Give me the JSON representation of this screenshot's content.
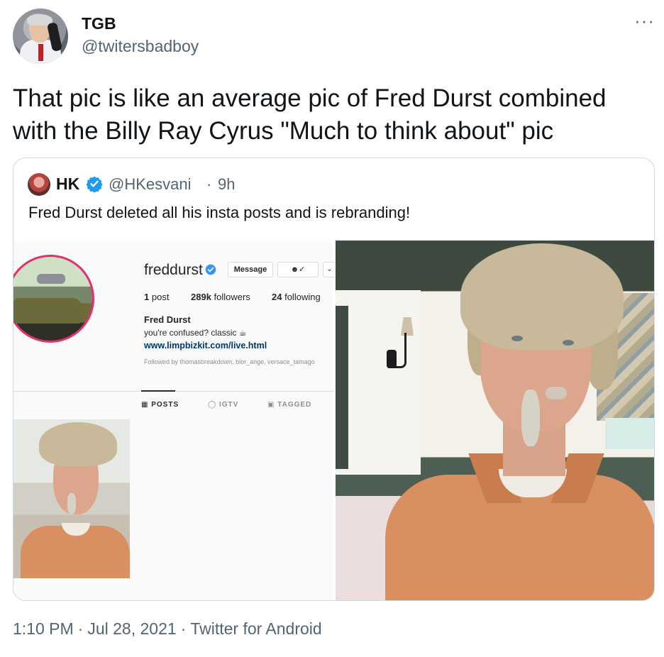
{
  "tweet": {
    "author_name": "TGB",
    "author_handle": "@twitersbadboy",
    "more_icon": "more-horizontal-icon",
    "text": "That pic is like an average pic of Fred Durst combined with the Billy Ray Cyrus \"Much to think about\" pic",
    "time": "1:10 PM",
    "date": "Jul 28, 2021",
    "source": "Twitter for Android",
    "separator": "·"
  },
  "quoted_tweet": {
    "author_name": "HK",
    "author_handle": "@HKesvani",
    "separator": "·",
    "age": "9h",
    "text": "Fred Durst deleted all his insta posts and is rebranding!",
    "verified_icon": "verified-badge-icon",
    "colors": {
      "verified": "#1d9bf0"
    }
  },
  "instagram": {
    "username": "freddurst",
    "message_button": "Message",
    "follow_icon": "person-check-icon",
    "dropdown_icon": "chevron-down-icon",
    "posts_count": "1",
    "posts_label": "post",
    "followers_count": "289k",
    "followers_label": "followers",
    "following_count": "24",
    "following_label": "following",
    "full_name": "Fred Durst",
    "bio": "you're confused? classic ☕",
    "link": "www.limpbizkit.com/live.html",
    "followed_by": "Followed by thomasbreakdown, blor_ange, versace_tamago",
    "tabs": [
      {
        "label": "POSTS",
        "icon": "grid-icon"
      },
      {
        "label": "IGTV",
        "icon": "igtv-icon"
      },
      {
        "label": "TAGGED",
        "icon": "tag-icon"
      }
    ]
  },
  "colors": {
    "text_primary": "#0f1419",
    "text_secondary": "#536471",
    "border": "#cfd9de",
    "ig_ring": "#e1306c",
    "ig_link": "#00376b"
  }
}
